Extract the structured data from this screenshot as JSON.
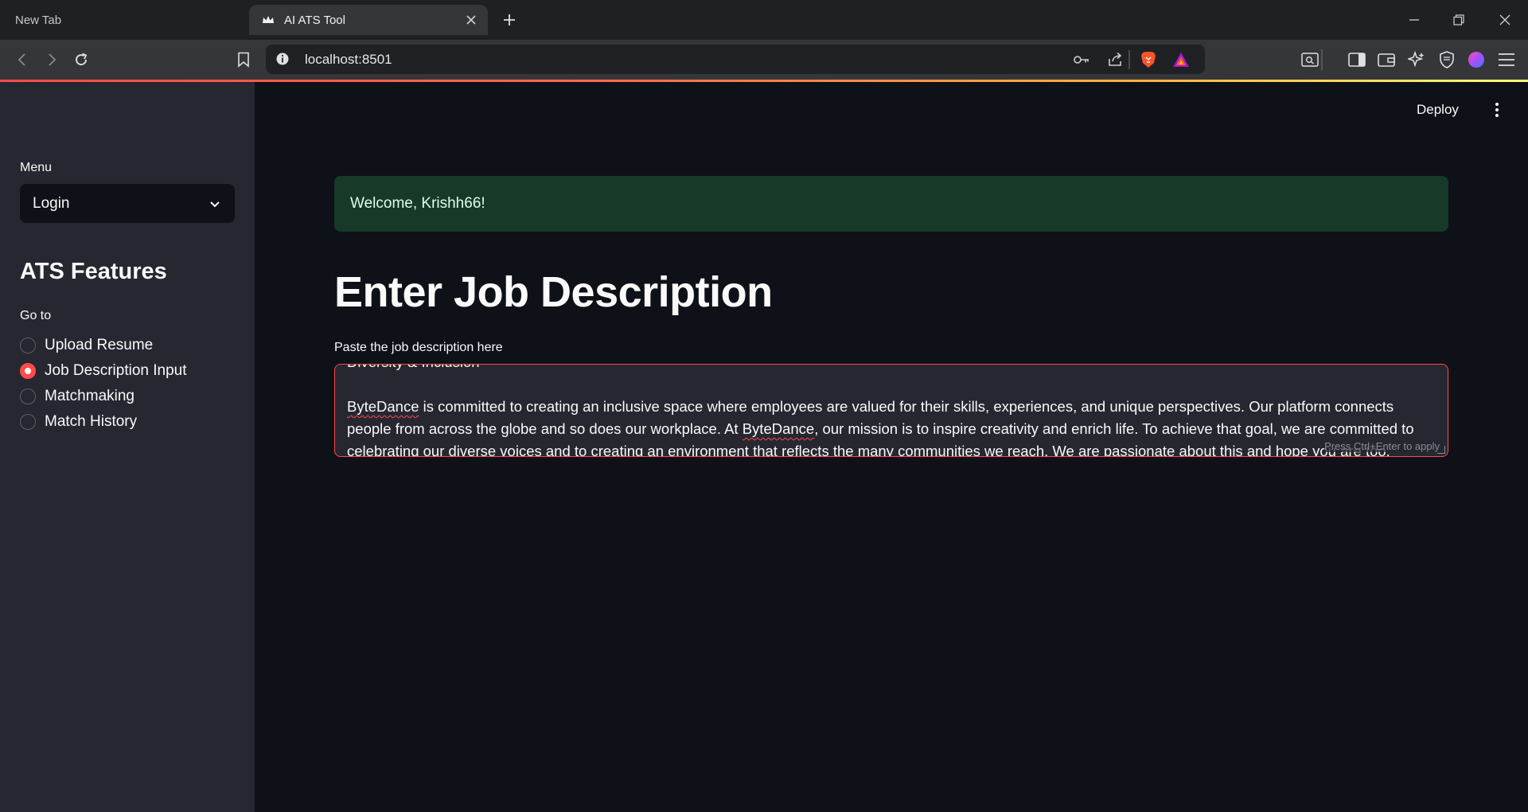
{
  "browser": {
    "tabs": [
      {
        "label": "New Tab",
        "active": false
      },
      {
        "label": "AI ATS Tool",
        "active": true
      }
    ],
    "url": "localhost:8501",
    "accent_color": "#ff4b4b"
  },
  "icons": {
    "back": "arrow-left-icon",
    "forward": "arrow-right-icon",
    "reload": "reload-icon",
    "bookmark": "bookmark-icon",
    "site_info": "info-icon",
    "password": "key-icon",
    "share": "share-icon",
    "brave_shields": "brave-lion-icon",
    "brave_rewards": "brave-triangle-icon"
  },
  "header": {
    "deploy_label": "Deploy"
  },
  "sidebar": {
    "menu_label": "Menu",
    "menu_value": "Login",
    "heading": "ATS Features",
    "goto_label": "Go to",
    "options": [
      {
        "label": "Upload Resume",
        "checked": false
      },
      {
        "label": "Job Description Input",
        "checked": true
      },
      {
        "label": "Matchmaking",
        "checked": false
      },
      {
        "label": "Match History",
        "checked": false
      }
    ]
  },
  "main": {
    "welcome": "Welcome, Krishh66!",
    "title": "Enter Job Description",
    "textarea_label": "Paste the job description here",
    "textarea_hint": "Press Ctrl+Enter to apply",
    "textarea_lines": {
      "l1": "Diversity & Inclusion",
      "l2a": "ByteDance",
      "l2b": " is committed to creating an inclusive space where employees are valued for their skills, experiences, and unique perspectives. Our platform connects",
      "l3a": "people from across the globe and so does our workplace. At ",
      "l3b": "ByteDance",
      "l3c": ", our mission is to inspire creativity and enrich life. To achieve that goal, we are committed to",
      "l4": "celebrating our diverse voices and to creating an environment that reflects the many communities we reach. We are passionate about this and hope you are too."
    }
  }
}
